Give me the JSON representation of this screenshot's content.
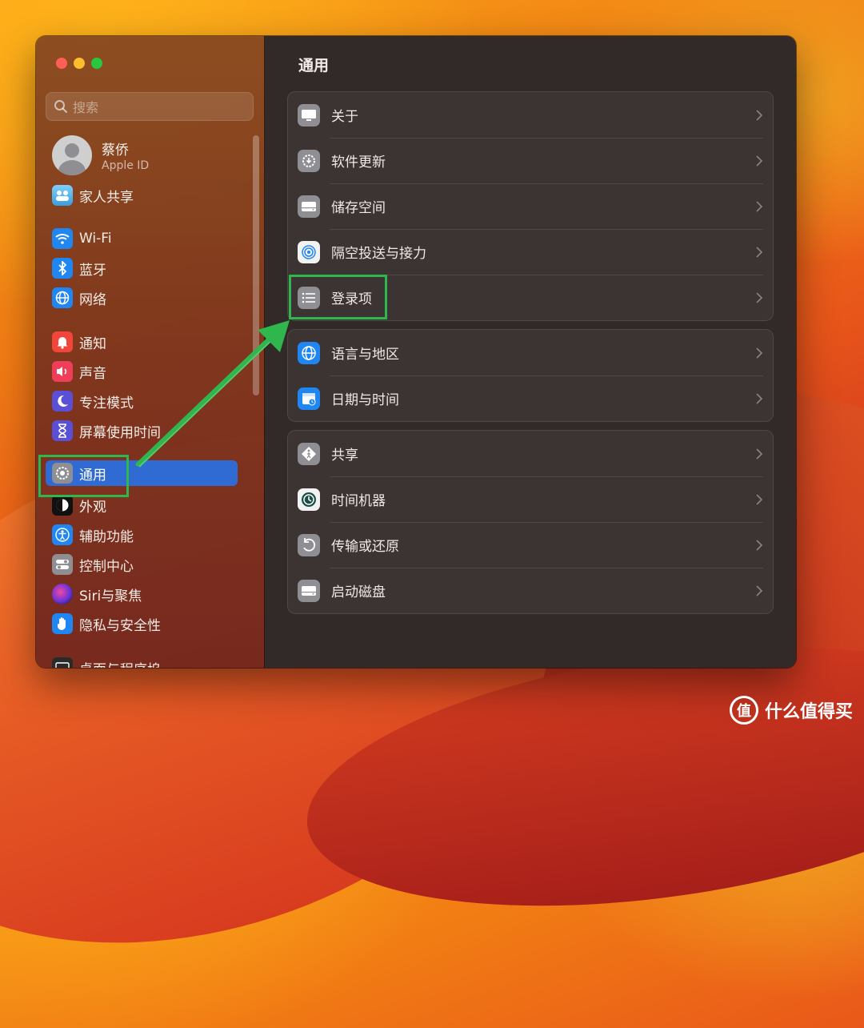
{
  "sidebar": {
    "search_placeholder": "搜索",
    "account": {
      "name": "蔡侨",
      "subtitle": "Apple ID"
    },
    "items": [
      {
        "label": "家人共享",
        "icon": "family-icon"
      },
      {
        "label": "Wi-Fi",
        "icon": "wifi-icon"
      },
      {
        "label": "蓝牙",
        "icon": "bluetooth-icon"
      },
      {
        "label": "网络",
        "icon": "network-icon"
      },
      {
        "label": "通知",
        "icon": "bell-icon"
      },
      {
        "label": "声音",
        "icon": "speaker-icon"
      },
      {
        "label": "专注模式",
        "icon": "moon-icon"
      },
      {
        "label": "屏幕使用时间",
        "icon": "hourglass-icon"
      },
      {
        "label": "通用",
        "icon": "gear-icon",
        "selected": true
      },
      {
        "label": "外观",
        "icon": "appearance-icon"
      },
      {
        "label": "辅助功能",
        "icon": "accessibility-icon"
      },
      {
        "label": "控制中心",
        "icon": "control-center-icon"
      },
      {
        "label": "Siri与聚焦",
        "icon": "siri-icon"
      },
      {
        "label": "隐私与安全性",
        "icon": "hand-icon"
      },
      {
        "label": "桌面与程序坞",
        "icon": "desktop-icon"
      }
    ]
  },
  "main": {
    "title": "通用",
    "groups": [
      [
        {
          "label": "关于",
          "icon": "display-icon"
        },
        {
          "label": "软件更新",
          "icon": "software-update-icon"
        },
        {
          "label": "储存空间",
          "icon": "storage-icon"
        },
        {
          "label": "隔空投送与接力",
          "icon": "airdrop-icon"
        },
        {
          "label": "登录项",
          "icon": "list-icon"
        }
      ],
      [
        {
          "label": "语言与地区",
          "icon": "globe-icon"
        },
        {
          "label": "日期与时间",
          "icon": "calendar-icon"
        }
      ],
      [
        {
          "label": "共享",
          "icon": "sharing-icon"
        },
        {
          "label": "时间机器",
          "icon": "time-machine-icon"
        },
        {
          "label": "传输或还原",
          "icon": "restore-icon"
        },
        {
          "label": "启动磁盘",
          "icon": "startup-disk-icon"
        }
      ]
    ]
  },
  "watermark": {
    "logo_glyph": "值",
    "text": "什么值得买"
  },
  "colors": {
    "selection": "#2f6bd2",
    "highlight": "#2fb74d",
    "pane_bg": "#312a29"
  }
}
